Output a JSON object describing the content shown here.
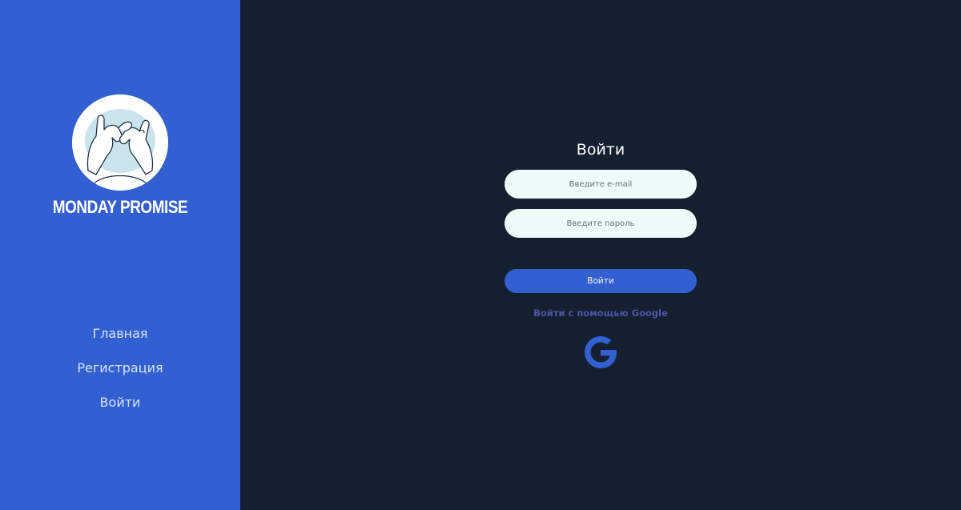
{
  "brand": {
    "name": "MONDAY PROMISE",
    "colors": {
      "sidebar": "#3360d0",
      "background": "#141f2f",
      "field": "#ecfcfb",
      "accent": "#3360d0"
    }
  },
  "nav": {
    "items": [
      {
        "label": "Главная"
      },
      {
        "label": "Регистрация"
      },
      {
        "label": "Войти"
      }
    ]
  },
  "login": {
    "title": "Войти",
    "email_placeholder": "Введите e-mail",
    "password_placeholder": "Введите пароль",
    "submit_label": "Войти",
    "google_label": "Войти с помощью Google",
    "google_icon": "google-g-icon"
  }
}
